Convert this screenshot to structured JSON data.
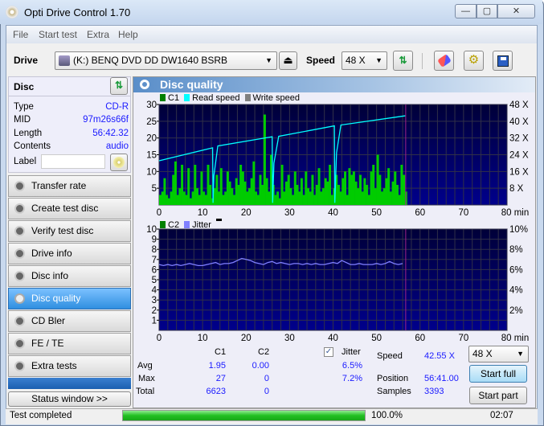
{
  "window": {
    "title": "Opti Drive Control 1.70",
    "minimize": "—",
    "maximize": "▢",
    "close": "✕"
  },
  "menu": [
    "File",
    "Start test",
    "Extra",
    "Help"
  ],
  "toolbar": {
    "drive_label": "Drive",
    "drive_value": "(K:)   BENQ DVD DD DW1640 BSRB",
    "speed_label": "Speed",
    "speed_value": "48 X"
  },
  "disc": {
    "header": "Disc",
    "rows": [
      {
        "key": "Type",
        "value": "CD-R"
      },
      {
        "key": "MID",
        "value": "97m26s66f"
      },
      {
        "key": "Length",
        "value": "56:42.32"
      },
      {
        "key": "Contents",
        "value": "audio"
      }
    ],
    "label_key": "Label",
    "label_value": ""
  },
  "nav": [
    "Transfer rate",
    "Create test disc",
    "Verify test disc",
    "Drive info",
    "Disc info",
    "Disc quality",
    "CD Bler",
    "FE / TE",
    "Extra tests"
  ],
  "nav_selected": "Disc quality",
  "status_window_button": "Status window >>",
  "panel_title": "Disc quality",
  "chart_data": [
    {
      "type": "bar",
      "legend": [
        "C1",
        "Read speed",
        "Write speed"
      ],
      "colors": {
        "C1": "#00cc00",
        "Read speed": "#00ffff",
        "Write speed": "#808080"
      },
      "x_ticks": [
        "0",
        "10",
        "20",
        "30",
        "40",
        "50",
        "60",
        "70",
        "80 min"
      ],
      "xlim": [
        0,
        80
      ],
      "y_ticks": [
        "5",
        "10",
        "15",
        "20",
        "25",
        "30"
      ],
      "ylim": [
        0,
        30
      ],
      "y2_ticks": [
        "8 X",
        "16 X",
        "24 X",
        "32 X",
        "40 X",
        "48 X"
      ],
      "y2lim": [
        0,
        48
      ],
      "c1_x_start": 0,
      "c1_x_step": 0.5,
      "c1_values": [
        3,
        4,
        8,
        3,
        2,
        4,
        9,
        13,
        3,
        5,
        12,
        4,
        3,
        11,
        2,
        4,
        12,
        5,
        3,
        10,
        4,
        3,
        12,
        6,
        2,
        5,
        9,
        4,
        11,
        3,
        4,
        10,
        7,
        5,
        3,
        8,
        6,
        12,
        10,
        7,
        4,
        5,
        8,
        13,
        4,
        3,
        9,
        6,
        27,
        8,
        4,
        15,
        6,
        3,
        4,
        2,
        12,
        4,
        7,
        9,
        5,
        3,
        10,
        6,
        4,
        8,
        3,
        10,
        5,
        4,
        9,
        3,
        6,
        11,
        4,
        5,
        8,
        7,
        12,
        3,
        5,
        9,
        6,
        4,
        8,
        10,
        3,
        11,
        9,
        10,
        7,
        5,
        9,
        4,
        8,
        6,
        3,
        10,
        12,
        5,
        15,
        9,
        4,
        5,
        8,
        11,
        4,
        7,
        10,
        6,
        3,
        12,
        9,
        4
      ],
      "read_speed": [
        [
          0,
          21.1
        ],
        [
          12.3,
          27.3
        ],
        [
          12.4,
          1
        ],
        [
          12.6,
          14
        ],
        [
          13.5,
          28.2
        ],
        [
          26,
          32.6
        ],
        [
          26.1,
          1
        ],
        [
          26.4,
          20
        ],
        [
          27.5,
          32.8
        ],
        [
          40.3,
          37.8
        ],
        [
          40.4,
          1
        ],
        [
          40.8,
          25
        ],
        [
          41.8,
          38.2
        ],
        [
          56.6,
          42.6
        ]
      ],
      "end_marker": 56.7,
      "grid": true
    },
    {
      "type": "line",
      "legend": [
        "C2",
        "Jitter"
      ],
      "colors": {
        "C2": "#008000",
        "Jitter": "#8080ff"
      },
      "x_ticks": [
        "0",
        "10",
        "20",
        "30",
        "40",
        "50",
        "60",
        "70",
        "80 min"
      ],
      "xlim": [
        0,
        80
      ],
      "y_ticks": [
        "1",
        "2",
        "3",
        "4",
        "5",
        "6",
        "7",
        "8",
        "9",
        "10"
      ],
      "ylim": [
        0,
        10
      ],
      "y2_ticks": [
        "2%",
        "4%",
        "6%",
        "8%",
        "10%"
      ],
      "y2lim": [
        0,
        10
      ],
      "c2_values": [],
      "jitter_x_start": 0,
      "jitter_x_step": 1,
      "jitter_values": [
        6.5,
        6.4,
        6.5,
        6.4,
        6.5,
        6.4,
        6.5,
        6.6,
        6.5,
        6.4,
        6.4,
        6.5,
        6.6,
        6.7,
        6.5,
        6.6,
        6.6,
        6.7,
        6.9,
        7.1,
        7.0,
        6.9,
        6.7,
        6.6,
        6.5,
        6.7,
        6.8,
        6.6,
        6.7,
        6.6,
        6.5,
        6.6,
        6.6,
        6.5,
        6.6,
        6.5,
        6.6,
        6.5,
        6.5,
        6.6,
        6.7,
        6.6,
        6.9,
        6.7,
        6.5,
        6.5,
        6.6,
        6.5,
        6.5,
        6.5,
        6.6,
        6.5,
        6.6,
        6.8,
        6.6,
        6.5,
        6.6
      ],
      "end_marker": 56.7,
      "grid": true
    }
  ],
  "stats": {
    "col_c1": "C1",
    "col_c2": "C2",
    "jitter_label": "Jitter",
    "jitter_checked": true,
    "rows": [
      {
        "label": "Avg",
        "c1": "1.95",
        "c2": "0.00",
        "jitter": "6.5%"
      },
      {
        "label": "Max",
        "c1": "27",
        "c2": "0",
        "jitter": "7.2%"
      },
      {
        "label": "Total",
        "c1": "6623",
        "c2": "0",
        "jitter": ""
      }
    ]
  },
  "info": {
    "speed_label": "Speed",
    "speed_value": "42.55 X",
    "position_label": "Position",
    "position_value": "56:41.00",
    "samples_label": "Samples",
    "samples_value": "3393"
  },
  "controls": {
    "speed_select": "48 X",
    "start_full": "Start full",
    "start_part": "Start part"
  },
  "status": {
    "text": "Test completed",
    "progress_percent": 100,
    "progress_label": "100.0%",
    "time": "02:07"
  }
}
